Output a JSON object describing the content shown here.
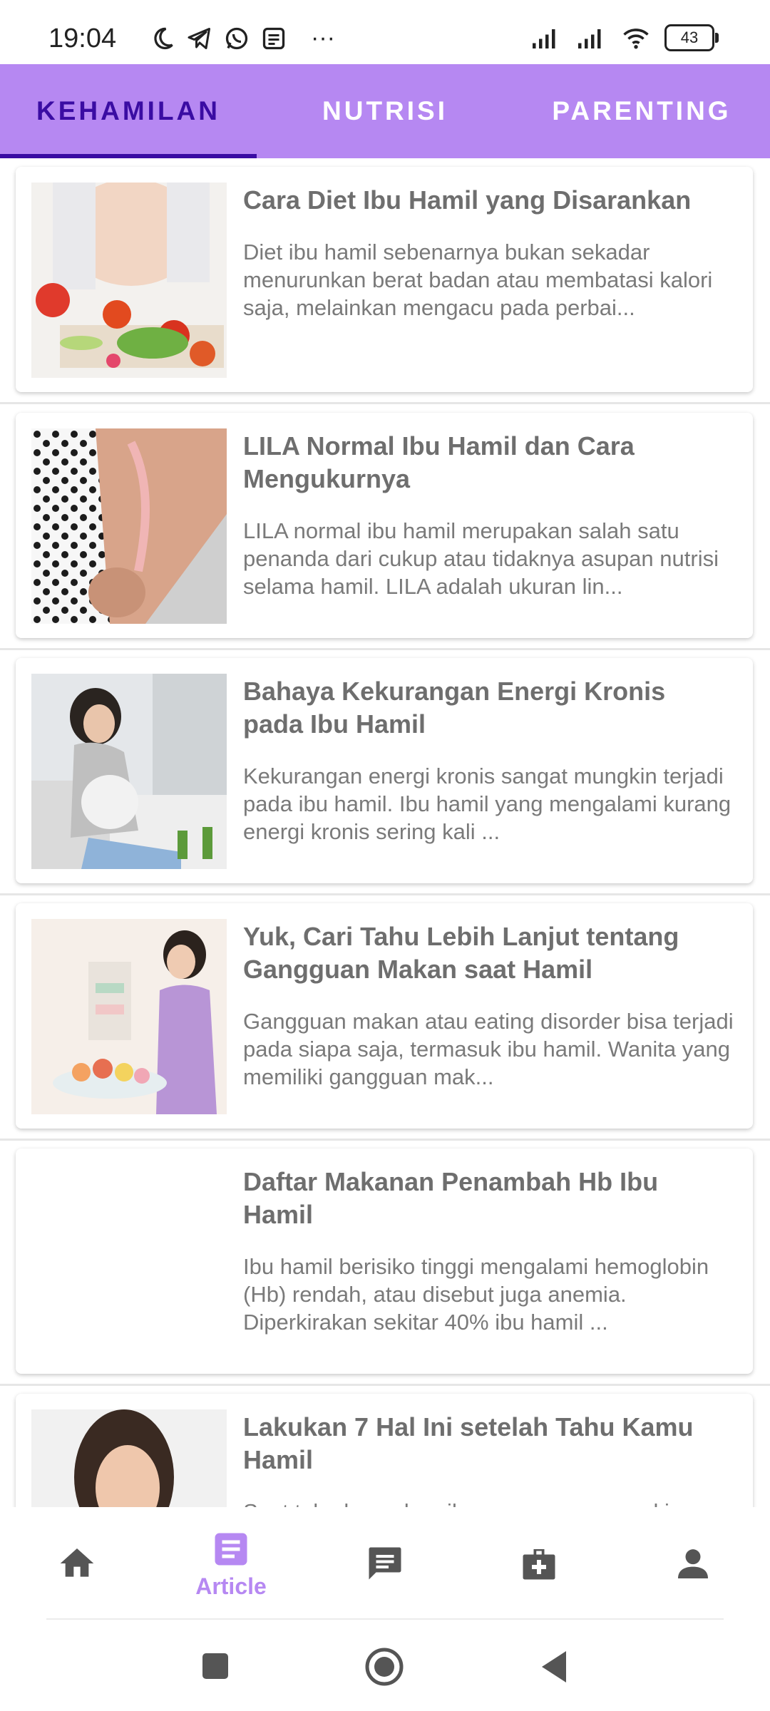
{
  "status_bar": {
    "time": "19:04",
    "more_dots": "···",
    "battery_level": "43",
    "left_icons": [
      "moon-icon",
      "telegram-icon",
      "whatsapp-icon",
      "notes-icon"
    ],
    "right_icons": [
      "signal-icon",
      "signal-icon",
      "wifi-icon",
      "battery-icon"
    ]
  },
  "tabs": [
    {
      "label": "KEHAMILAN",
      "active": true
    },
    {
      "label": "NUTRISI",
      "active": false
    },
    {
      "label": "PARENTING",
      "active": false
    }
  ],
  "articles": [
    {
      "title": "Cara Diet Ibu Hamil yang Disarankan",
      "description": "Diet ibu hamil sebenarnya bukan sekadar menurunkan berat badan atau membatasi kalori saja, melainkan mengacu pada perbai...",
      "image": "pregnant-woman-vegetables"
    },
    {
      "title": "LILA Normal Ibu Hamil dan Cara Mengukurnya",
      "description": "LILA normal ibu hamil merupakan salah satu penanda dari cukup atau tidaknya asupan nutrisi selama hamil. LILA adalah ukuran lin...",
      "image": "arm-measuring-tape"
    },
    {
      "title": "Bahaya Kekurangan Energi Kronis pada Ibu Hamil",
      "description": "Kekurangan energi kronis sangat mungkin terjadi pada ibu hamil. Ibu hamil yang mengalami kurang energi kronis sering kali ...",
      "image": "tired-pregnant-woman-sofa"
    },
    {
      "title": "Yuk, Cari Tahu Lebih Lanjut tentang Gangguan Makan saat Hamil",
      "description": "Gangguan makan atau eating disorder bisa terjadi pada siapa saja, termasuk ibu hamil. Wanita yang memiliki gangguan mak...",
      "image": "pregnant-woman-desserts"
    },
    {
      "title": "Daftar Makanan Penambah Hb Ibu Hamil",
      "description": "Ibu hamil berisiko tinggi mengalami hemoglobin (Hb) rendah, atau disebut juga anemia. Diperkirakan sekitar 40% ibu hamil ...",
      "image": ""
    },
    {
      "title": "Lakukan 7 Hal Ini setelah Tahu Kamu Hamil",
      "description": "Saat tahu kamu hamil, perasaanmu mungkin...",
      "image": "smiling-woman"
    }
  ],
  "bottom_nav": [
    {
      "icon": "home-icon",
      "label": "",
      "active": false
    },
    {
      "icon": "article-icon",
      "label": "Article",
      "active": true
    },
    {
      "icon": "chat-icon",
      "label": "",
      "active": false
    },
    {
      "icon": "medical-kit-icon",
      "label": "",
      "active": false
    },
    {
      "icon": "profile-icon",
      "label": "",
      "active": false
    }
  ],
  "colors": {
    "accent": "#b688f2",
    "tab_active": "#3a0ca3",
    "nav_inactive": "#555555",
    "title_text": "#6e6e6e",
    "desc_text": "#7a7a7a"
  }
}
